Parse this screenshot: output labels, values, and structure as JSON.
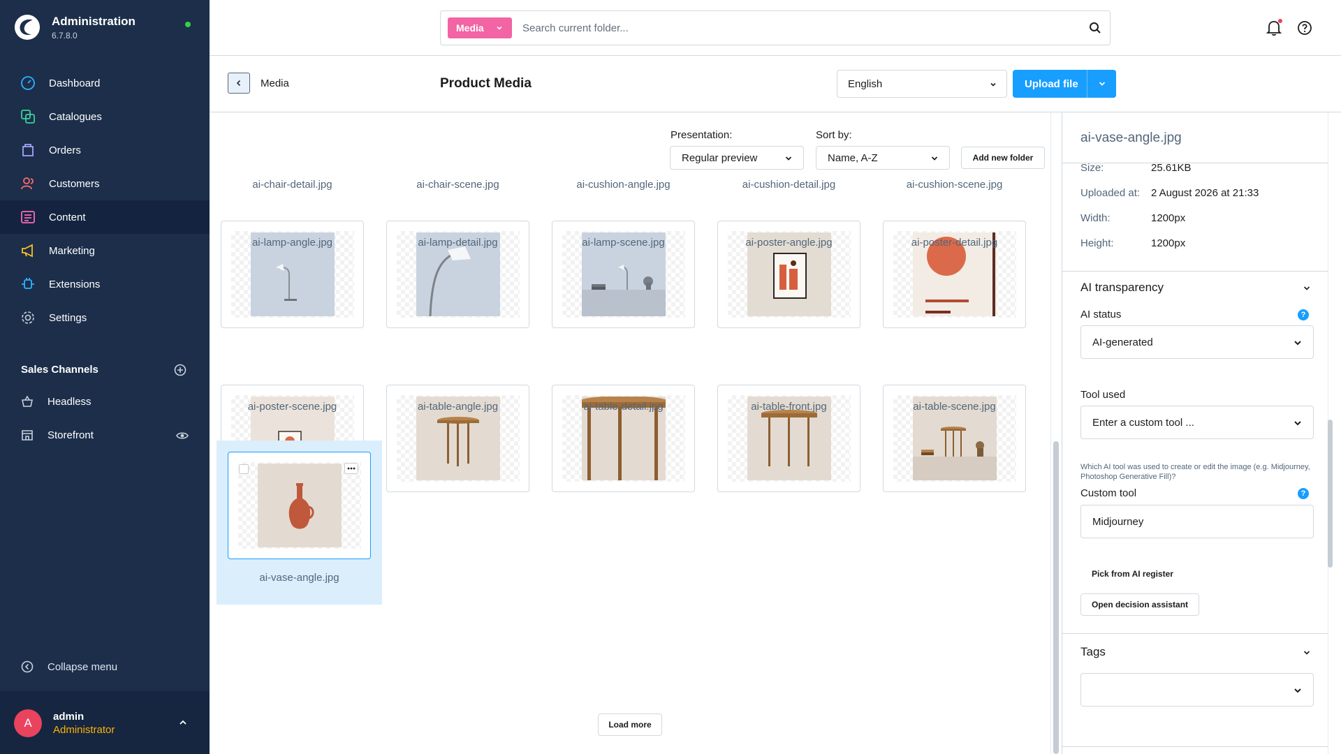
{
  "app": {
    "title": "Administration",
    "version": "6.7.8.0",
    "status_color": "#37d046"
  },
  "nav": {
    "items": [
      {
        "label": "Dashboard",
        "icon": "dashboard-icon"
      },
      {
        "label": "Catalogues",
        "icon": "catalogue-icon"
      },
      {
        "label": "Orders",
        "icon": "orders-icon"
      },
      {
        "label": "Customers",
        "icon": "customers-icon"
      },
      {
        "label": "Content",
        "icon": "content-icon",
        "active": true
      },
      {
        "label": "Marketing",
        "icon": "megaphone-icon"
      },
      {
        "label": "Extensions",
        "icon": "plug-icon"
      },
      {
        "label": "Settings",
        "icon": "gear-icon"
      }
    ]
  },
  "sales_channels": {
    "title": "Sales Channels",
    "items": [
      {
        "label": "Headless",
        "icon": "basket-icon"
      },
      {
        "label": "Storefront",
        "icon": "store-icon"
      }
    ]
  },
  "collapse_label": "Collapse menu",
  "user": {
    "initial": "A",
    "name": "admin",
    "role": "Administrator"
  },
  "search": {
    "type_label": "Media",
    "placeholder": "Search current folder..."
  },
  "smartbar": {
    "breadcrumb": "Media",
    "title": "Product Media",
    "language": "English",
    "upload_label": "Upload file"
  },
  "toolbar": {
    "presentation_label": "Presentation:",
    "presentation_value": "Regular preview",
    "sort_label": "Sort by:",
    "sort_value": "Name, A-Z",
    "add_folder_label": "Add new folder"
  },
  "media": {
    "cut_row": [
      "ai-chair-detail.jpg",
      "ai-chair-scene.jpg",
      "ai-cushion-angle.jpg",
      "ai-cushion-detail.jpg",
      "ai-cushion-scene.jpg"
    ],
    "rows": [
      [
        "ai-lamp-angle.jpg",
        "ai-lamp-detail.jpg",
        "ai-lamp-scene.jpg",
        "ai-poster-angle.jpg",
        "ai-poster-detail.jpg"
      ],
      [
        "ai-poster-scene.jpg",
        "ai-table-angle.jpg",
        "ai-table-detail.jpg",
        "ai-table-front.jpg",
        "ai-table-scene.jpg"
      ],
      [
        "ai-vase-angle.jpg"
      ]
    ],
    "selected": "ai-vase-angle.jpg",
    "load_more_label": "Load more"
  },
  "detail": {
    "file_name": "ai-vase-angle.jpg",
    "meta": [
      {
        "key": "Size:",
        "value": "25.61KB"
      },
      {
        "key": "Uploaded at:",
        "value": "2 August 2026 at 21:33"
      },
      {
        "key": "Width:",
        "value": "1200px"
      },
      {
        "key": "Height:",
        "value": "1200px"
      }
    ],
    "ai_section_title": "AI transparency",
    "ai_status_label": "AI status",
    "ai_status_value": "AI-generated",
    "tool_used_label": "Tool used",
    "tool_used_value": "Enter a custom tool ...",
    "help_text": "Which AI tool was used to create or edit the image (e.g. Midjourney, Photoshop Generative Fill)?",
    "custom_tool_label": "Custom tool",
    "custom_tool_value": "Midjourney",
    "pick_register_label": "Pick from AI register",
    "decision_assistant_label": "Open decision assistant",
    "tags_title": "Tags",
    "info_glyph": "?"
  },
  "colors": {
    "sidebar": "#1c2e4a",
    "accent": "#189eff",
    "media_tag": "#f264a4",
    "user_role": "#ffb200",
    "avatar": "#e9435d"
  }
}
